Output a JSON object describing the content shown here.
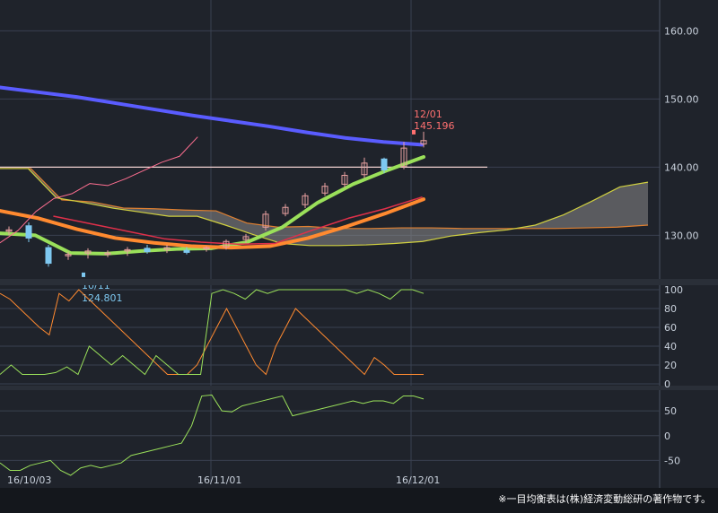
{
  "colors": {
    "background": "#1f232b",
    "grid": "#3a4150",
    "axis_text": "#c9d1dc",
    "tenkan": "#ff6f91",
    "kumo_fill": "#8a8a8a",
    "kumo_edge_a": "#d0d040",
    "kumo_edge_b": "#e08030",
    "ma_blue": "#5a5cff",
    "ma_green": "#9ae05a",
    "ma_orange": "#ff8a30",
    "candle_up": "#e8a0a0",
    "candle_down": "#7ec8f0",
    "hi_label": "#ff7070",
    "lo_label": "#7ec8f0",
    "stoch_k": "#ff8a30",
    "stoch_d": "#9ae05a",
    "rci": "#9ae05a"
  },
  "chart_data": [
    {
      "type": "line",
      "title": "",
      "x_labels": [
        "16/10/03",
        "16/11/01",
        "16/12/01"
      ],
      "y_ticks": [
        "160.00",
        "150.00",
        "140.00",
        "130.00"
      ],
      "ylim": [
        124,
        164
      ],
      "grid": true,
      "annotations": {
        "high": {
          "date": "12/01",
          "value": "145.196"
        },
        "low": {
          "date": "10/11",
          "value": "124.801"
        },
        "hline": 140.0
      },
      "series": [
        {
          "key": "blue",
          "values": [
            151.7,
            151.0,
            150.3,
            149.4,
            148.5,
            147.6,
            146.8,
            146.0,
            145.1,
            144.3,
            143.7,
            143.3
          ]
        },
        {
          "key": "green",
          "values": [
            130.3,
            130.0,
            127.4,
            127.3,
            127.7,
            128.0,
            128.1,
            129.0,
            131.2,
            134.8,
            137.5,
            139.6,
            141.5
          ]
        },
        {
          "key": "orange",
          "values": [
            133.6,
            132.5,
            130.9,
            129.6,
            128.9,
            128.4,
            128.2,
            128.4,
            129.6,
            131.3,
            133.2,
            135.3
          ]
        },
        {
          "key": "red",
          "values": [
            132.8,
            131.7,
            130.6,
            129.5,
            129.0,
            128.7,
            128.8,
            130.7,
            132.5,
            133.9,
            135.6
          ]
        },
        {
          "key": "pink",
          "values": [
            128.9,
            130.7,
            133.5,
            135.4,
            136.1,
            137.6,
            137.3,
            138.3,
            139.5,
            140.7,
            141.6,
            144.4
          ]
        }
      ],
      "cloud": {
        "span_a": [
          139.8,
          139.8,
          135.2,
          134.9,
          134.0,
          133.9,
          133.7,
          133.6,
          131.8,
          131.2,
          131.3,
          131.0,
          131.0,
          131.1,
          131.1,
          131.0,
          131.0,
          131.0,
          131.0,
          131.1,
          131.2,
          131.5
        ],
        "span_b": [
          139.8,
          139.8,
          135.5,
          134.8,
          134.0,
          133.4,
          132.8,
          132.8,
          131.5,
          130.1,
          128.8,
          128.5,
          128.5,
          128.6,
          128.8,
          129.1,
          129.9,
          130.4,
          130.8,
          131.5,
          133.0,
          135.0,
          137.1,
          137.8
        ]
      },
      "candles": [
        {
          "o": 130.6,
          "h": 131.3,
          "l": 130.0,
          "c": 130.8
        },
        {
          "o": 131.4,
          "h": 131.9,
          "l": 129.0,
          "c": 129.6
        },
        {
          "o": 128.2,
          "h": 128.6,
          "l": 125.4,
          "c": 125.9
        },
        {
          "o": 127.0,
          "h": 127.6,
          "l": 126.4,
          "c": 127.2
        },
        {
          "o": 127.4,
          "h": 128.1,
          "l": 126.6,
          "c": 127.7
        },
        {
          "o": 127.3,
          "h": 127.8,
          "l": 126.8,
          "c": 127.4
        },
        {
          "o": 127.7,
          "h": 128.3,
          "l": 127.0,
          "c": 127.9
        },
        {
          "o": 128.1,
          "h": 128.6,
          "l": 127.3,
          "c": 127.6
        },
        {
          "o": 127.9,
          "h": 128.6,
          "l": 127.4,
          "c": 128.2
        },
        {
          "o": 127.8,
          "h": 128.3,
          "l": 127.2,
          "c": 127.5
        },
        {
          "o": 128.0,
          "h": 128.4,
          "l": 127.6,
          "c": 128.2
        },
        {
          "o": 128.3,
          "h": 129.4,
          "l": 127.9,
          "c": 129.1
        },
        {
          "o": 129.4,
          "h": 130.2,
          "l": 128.9,
          "c": 129.8
        },
        {
          "o": 131.2,
          "h": 133.6,
          "l": 130.7,
          "c": 133.1
        },
        {
          "o": 133.2,
          "h": 134.6,
          "l": 132.8,
          "c": 134.1
        },
        {
          "o": 134.5,
          "h": 136.2,
          "l": 134.0,
          "c": 135.8
        },
        {
          "o": 136.2,
          "h": 137.7,
          "l": 135.8,
          "c": 137.2
        },
        {
          "o": 137.5,
          "h": 139.3,
          "l": 137.0,
          "c": 138.8
        },
        {
          "o": 138.9,
          "h": 141.4,
          "l": 138.4,
          "c": 140.6
        },
        {
          "o": 141.2,
          "h": 141.4,
          "l": 139.1,
          "c": 139.6
        },
        {
          "o": 140.1,
          "h": 143.7,
          "l": 139.7,
          "c": 142.8
        },
        {
          "o": 143.4,
          "h": 145.2,
          "l": 142.9,
          "c": 143.9
        }
      ]
    },
    {
      "type": "line",
      "title": "",
      "y_ticks": [
        "100",
        "80",
        "60",
        "40",
        "20",
        "0"
      ],
      "ylim": [
        0,
        100
      ],
      "series": [
        {
          "key": "k",
          "values": [
            96,
            90,
            80,
            70,
            60,
            52,
            96,
            88,
            100,
            90,
            80,
            70,
            60,
            50,
            40,
            30,
            20,
            10,
            10,
            10,
            20,
            40,
            60,
            80,
            60,
            40,
            20,
            10,
            40,
            60,
            80,
            70,
            60,
            50,
            40,
            30,
            20,
            10,
            28,
            20,
            10,
            10,
            10,
            10
          ]
        },
        {
          "key": "d",
          "values": [
            10,
            20,
            10,
            10,
            10,
            12,
            18,
            10,
            40,
            30,
            20,
            30,
            20,
            10,
            30,
            20,
            10,
            10,
            10,
            96,
            100,
            96,
            90,
            100,
            96,
            100,
            100,
            100,
            100,
            100,
            100,
            100,
            96,
            100,
            96,
            90,
            100,
            100,
            96
          ]
        }
      ]
    },
    {
      "type": "line",
      "title": "",
      "y_ticks": [
        "50",
        "0",
        "-50"
      ],
      "ylim": [
        -80,
        90
      ],
      "series": [
        {
          "key": "rci",
          "values": [
            -55,
            -70,
            -70,
            -60,
            -55,
            -50,
            -70,
            -80,
            -65,
            -60,
            -65,
            -60,
            -55,
            -40,
            -35,
            -30,
            -25,
            -20,
            -15,
            20,
            80,
            82,
            50,
            48,
            60,
            65,
            70,
            75,
            80,
            40,
            45,
            50,
            55,
            60,
            65,
            70,
            65,
            70,
            70,
            65,
            80,
            80,
            74
          ]
        }
      ]
    }
  ],
  "footer": {
    "copyright": "※一目均衡表は(株)経済変動総研の著作物です。"
  }
}
